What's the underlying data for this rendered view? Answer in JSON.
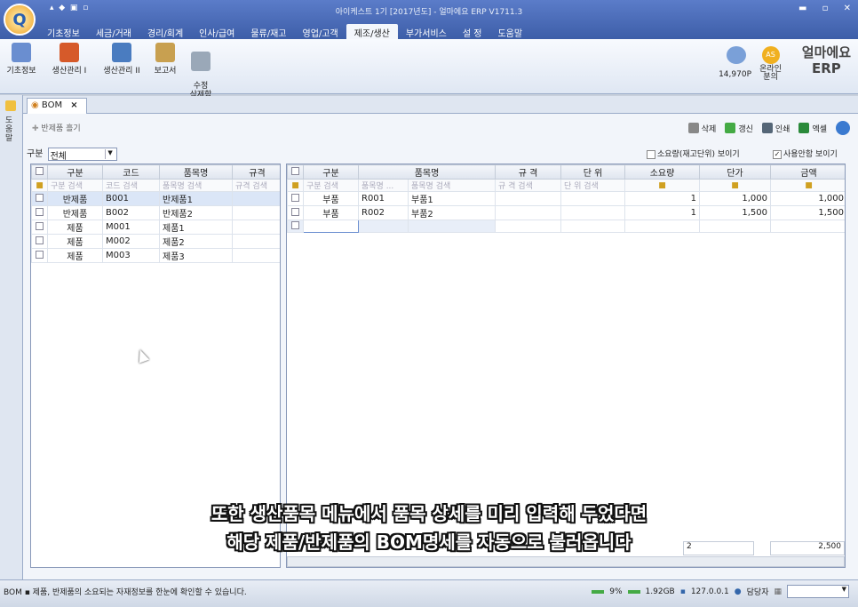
{
  "window": {
    "title": "아이케스트 1기 [2017년도] - 얼마에요 ERP V1711.3"
  },
  "menu": [
    "기초정보",
    "세금/거래",
    "경리/회계",
    "인사/급여",
    "물류/재고",
    "영업/고객",
    "제조/생산",
    "부가서비스",
    "설 정",
    "도움말"
  ],
  "ribbon": {
    "buttons": [
      "기초정보",
      "생산관리 I",
      "생산관리 II",
      "보고서",
      "수정\n삭제함"
    ],
    "points": "14,970P",
    "online_label": "온라인\n분의",
    "online_badge": "AS",
    "brand_line1": "얼마에요",
    "brand_line2": "ERP"
  },
  "left_strip": "도움말",
  "doc_tab": {
    "label": "BOM",
    "close": "×"
  },
  "toolbar": {
    "left": "반제품 흘기",
    "delete": "삭제",
    "refresh": "갱신",
    "print": "인쇄",
    "excel": "엑셀"
  },
  "filter": {
    "label": "구분",
    "value": "전체"
  },
  "options": {
    "show_qty": "소요량(재고단위) 보이기",
    "show_unused": "사용안함 보이기"
  },
  "left_grid": {
    "headers": [
      "구분",
      "코드",
      "품목명",
      "규격"
    ],
    "search": [
      "구분 검색",
      "코드 검색",
      "품목명 검색",
      "규격 검색"
    ],
    "rows": [
      [
        "반제품",
        "B001",
        "반제품1",
        ""
      ],
      [
        "반제품",
        "B002",
        "반제품2",
        ""
      ],
      [
        "제품",
        "M001",
        "제품1",
        ""
      ],
      [
        "제품",
        "M002",
        "제품2",
        ""
      ],
      [
        "제품",
        "M003",
        "제품3",
        ""
      ]
    ]
  },
  "right_grid": {
    "headers": [
      "구분",
      "품목명",
      "규 격",
      "단 위",
      "소요량",
      "단가",
      "금액"
    ],
    "search": [
      "구분 검색",
      "품목명 ...",
      "품목명 검색",
      "규 격 검색",
      "단 위 검색"
    ],
    "rows": [
      [
        "부품",
        "R001",
        "부품1",
        "",
        "",
        "1",
        "1,000",
        "1,000"
      ],
      [
        "부품",
        "R002",
        "부품2",
        "",
        "",
        "1",
        "1,500",
        "1,500"
      ]
    ],
    "sum_qty": "2",
    "sum_amount": "2,500"
  },
  "subtitle": {
    "line1": "또한 생산품목 메뉴에서 품목 상세를 미리 입력해 두었다면",
    "line2": "해당 제품/반제품의 BOM명세를 자동으로 불러옵니다"
  },
  "status": {
    "left": "BOM  ▪  제품, 반제품의 소요되는 자재정보를 한눈에 확인할 수 있습니다.",
    "cpu": "9%",
    "mem": "1.92GB",
    "ip": "127.0.0.1",
    "user": "담당자"
  }
}
